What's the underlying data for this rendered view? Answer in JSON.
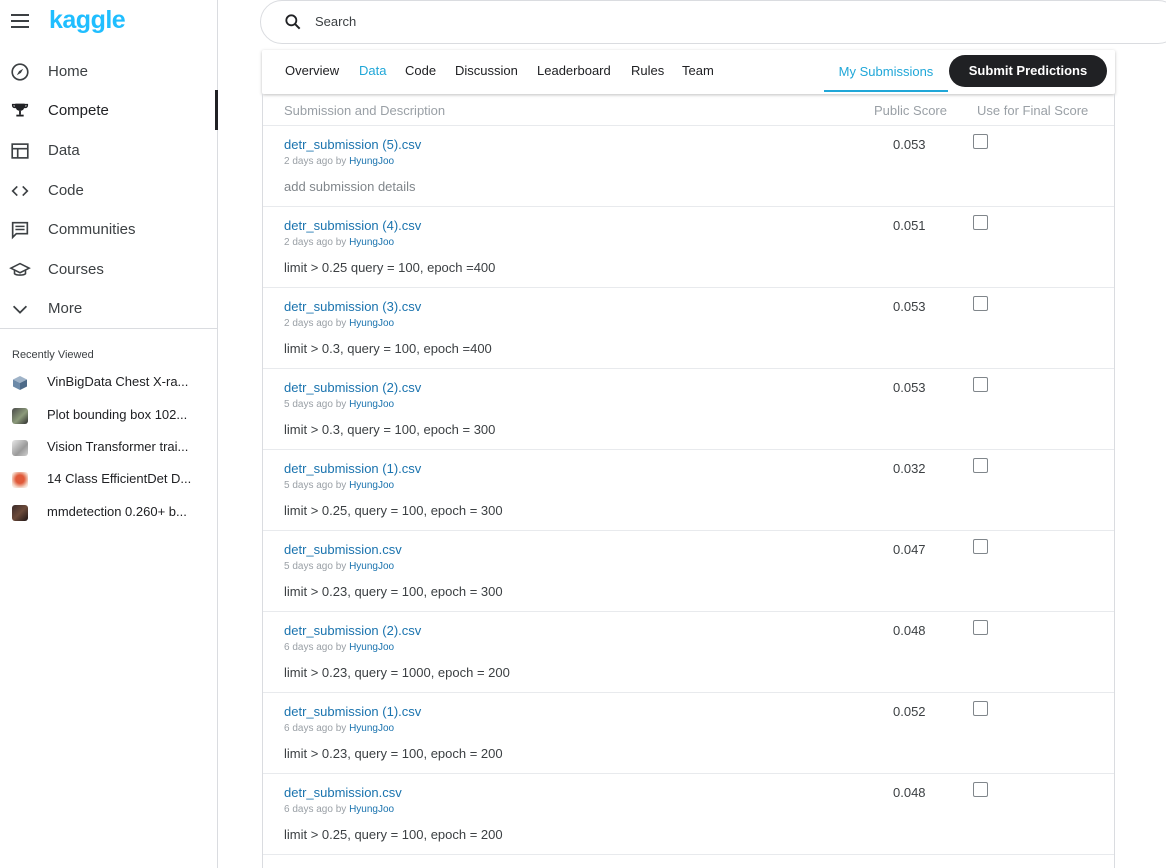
{
  "app": {
    "logo_text": "kaggle",
    "brand_color": "#20beff"
  },
  "search": {
    "placeholder": "Search"
  },
  "sidebar": {
    "items": [
      {
        "label": "Home",
        "icon": "compass-icon"
      },
      {
        "label": "Compete",
        "icon": "trophy-icon",
        "active": true
      },
      {
        "label": "Data",
        "icon": "table-icon"
      },
      {
        "label": "Code",
        "icon": "code-icon"
      },
      {
        "label": "Communities",
        "icon": "comment-icon"
      },
      {
        "label": "Courses",
        "icon": "graduation-cap-icon"
      },
      {
        "label": "More",
        "icon": "chevron-down-icon"
      }
    ],
    "recent_title": "Recently Viewed",
    "recent": [
      {
        "label": "VinBigData Chest X-ra..."
      },
      {
        "label": "Plot bounding box 102..."
      },
      {
        "label": "Vision Transformer trai..."
      },
      {
        "label": "14 Class EfficientDet D..."
      },
      {
        "label": "mmdetection 0.260+ b..."
      }
    ]
  },
  "tabs": [
    {
      "label": "Overview"
    },
    {
      "label": "Data",
      "active": true
    },
    {
      "label": "Code"
    },
    {
      "label": "Discussion"
    },
    {
      "label": "Leaderboard"
    },
    {
      "label": "Rules"
    },
    {
      "label": "Team"
    }
  ],
  "my_submissions_label": "My Submissions",
  "submit_label": "Submit Predictions",
  "table": {
    "headers": {
      "description": "Submission and Description",
      "score": "Public Score",
      "final": "Use for Final Score"
    },
    "by_word": "by",
    "rows": [
      {
        "file": "detr_submission (5).csv",
        "time": "2 days ago",
        "user": "HyungJoo",
        "desc": "add submission details",
        "placeholder": true,
        "score": "0.053"
      },
      {
        "file": "detr_submission (4).csv",
        "time": "2 days ago",
        "user": "HyungJoo",
        "desc": "limit > 0.25 query = 100, epoch =400",
        "score": "0.051"
      },
      {
        "file": "detr_submission (3).csv",
        "time": "2 days ago",
        "user": "HyungJoo",
        "desc": "limit > 0.3, query = 100, epoch =400",
        "score": "0.053"
      },
      {
        "file": "detr_submission (2).csv",
        "time": "5 days ago",
        "user": "HyungJoo",
        "desc": "limit > 0.3, query = 100, epoch = 300",
        "score": "0.053"
      },
      {
        "file": "detr_submission (1).csv",
        "time": "5 days ago",
        "user": "HyungJoo",
        "desc": "limit > 0.25, query = 100, epoch = 300",
        "score": "0.032"
      },
      {
        "file": "detr_submission.csv",
        "time": "5 days ago",
        "user": "HyungJoo",
        "desc": "limit > 0.23, query = 100, epoch = 300",
        "score": "0.047"
      },
      {
        "file": "detr_submission (2).csv",
        "time": "6 days ago",
        "user": "HyungJoo",
        "desc": "limit > 0.23, query = 1000, epoch = 200",
        "score": "0.048"
      },
      {
        "file": "detr_submission (1).csv",
        "time": "6 days ago",
        "user": "HyungJoo",
        "desc": "limit > 0.23, query = 100, epoch = 200",
        "score": "0.052"
      },
      {
        "file": "detr_submission.csv",
        "time": "6 days ago",
        "user": "HyungJoo",
        "desc": "limit > 0.25, query = 100, epoch = 200",
        "score": "0.048"
      }
    ]
  }
}
